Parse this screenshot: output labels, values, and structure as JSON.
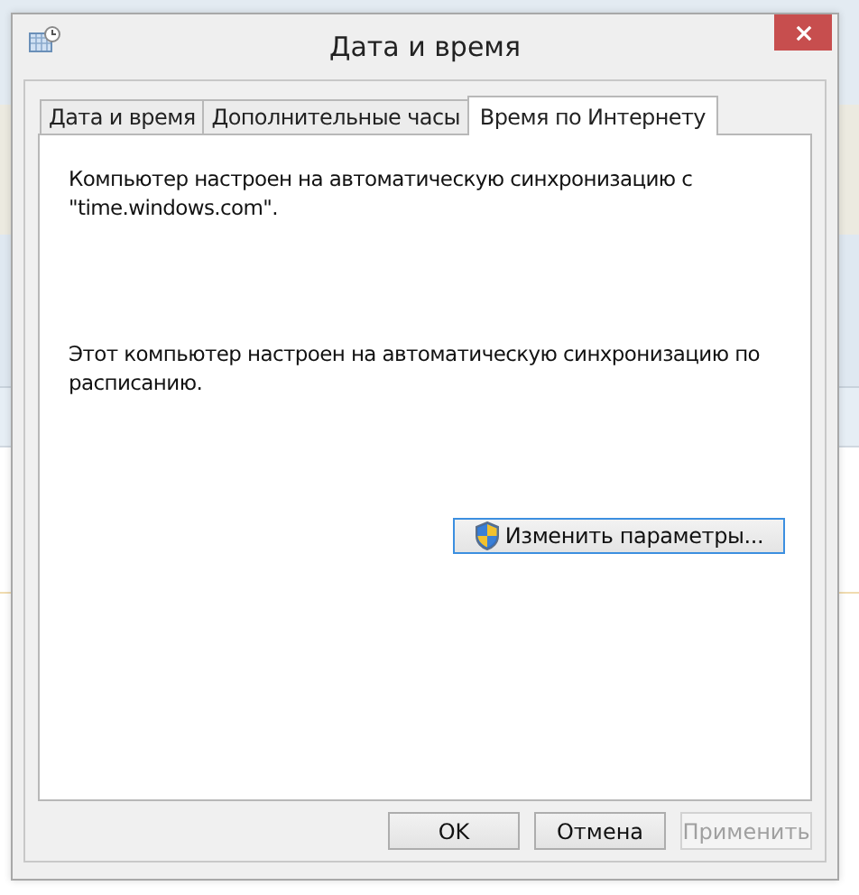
{
  "window": {
    "title": "Дата и время"
  },
  "tabs": [
    {
      "label": "Дата и время",
      "selected": false
    },
    {
      "label": "Дополнительные часы",
      "selected": false
    },
    {
      "label": "Время по Интернету",
      "selected": true
    }
  ],
  "content": {
    "sync_text": "Компьютер настроен на автоматическую синхронизацию с \"time.windows.com\".",
    "schedule_text": "Этот компьютер настроен на автоматическую синхронизацию по расписанию.",
    "change_button": "Изменить параметры..."
  },
  "buttons": [
    {
      "label": "OK",
      "disabled": false
    },
    {
      "label": "Отмена",
      "disabled": false
    },
    {
      "label": "Применить",
      "disabled": true
    }
  ]
}
